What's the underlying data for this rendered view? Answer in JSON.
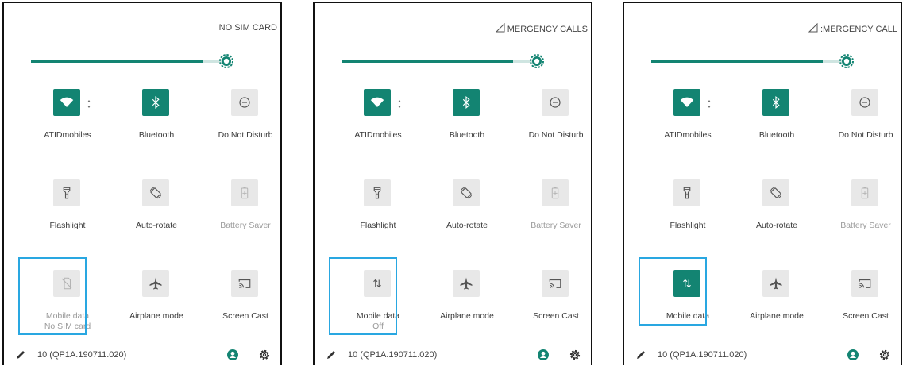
{
  "colors": {
    "accent": "#138472",
    "highlight": "#29a7e1",
    "tile_off": "#e8e8e8"
  },
  "panels": [
    {
      "status_text": "NO SIM CARD",
      "status_icon": "",
      "tiles": [
        {
          "label": "ATIDmobiles",
          "sub": "",
          "icon": "wifi-icon",
          "state": "on"
        },
        {
          "label": "Bluetooth",
          "sub": "",
          "icon": "bluetooth-icon",
          "state": "on"
        },
        {
          "label": "Do Not Disturb",
          "sub": "",
          "icon": "do-not-disturb-icon",
          "state": "off"
        },
        {
          "label": "Flashlight",
          "sub": "",
          "icon": "flashlight-icon",
          "state": "off"
        },
        {
          "label": "Auto-rotate",
          "sub": "",
          "icon": "auto-rotate-icon",
          "state": "off"
        },
        {
          "label": "Battery Saver",
          "sub": "",
          "icon": "battery-saver-icon",
          "state": "disabled"
        },
        {
          "label": "Mobile data",
          "sub": "No SIM card",
          "icon": "mobile-data-off-icon",
          "state": "disabled"
        },
        {
          "label": "Airplane mode",
          "sub": "",
          "icon": "airplane-icon",
          "state": "off"
        },
        {
          "label": "Screen Cast",
          "sub": "",
          "icon": "screen-cast-icon",
          "state": "off"
        }
      ],
      "build": "10 (QP1A.190711.020)"
    },
    {
      "status_text": "MERGENCY CALLS",
      "status_icon": "signal-icon",
      "tiles": [
        {
          "label": "ATIDmobiles",
          "sub": "",
          "icon": "wifi-icon",
          "state": "on"
        },
        {
          "label": "Bluetooth",
          "sub": "",
          "icon": "bluetooth-icon",
          "state": "on"
        },
        {
          "label": "Do Not Disturb",
          "sub": "",
          "icon": "do-not-disturb-icon",
          "state": "off"
        },
        {
          "label": "Flashlight",
          "sub": "",
          "icon": "flashlight-icon",
          "state": "off"
        },
        {
          "label": "Auto-rotate",
          "sub": "",
          "icon": "auto-rotate-icon",
          "state": "off"
        },
        {
          "label": "Battery Saver",
          "sub": "",
          "icon": "battery-saver-icon",
          "state": "disabled"
        },
        {
          "label": "Mobile data",
          "sub": "Off",
          "icon": "mobile-data-icon",
          "state": "off"
        },
        {
          "label": "Airplane mode",
          "sub": "",
          "icon": "airplane-icon",
          "state": "off"
        },
        {
          "label": "Screen Cast",
          "sub": "",
          "icon": "screen-cast-icon",
          "state": "off"
        }
      ],
      "build": "10 (QP1A.190711.020)"
    },
    {
      "status_text": ":MERGENCY CALL",
      "status_icon": "signal-icon",
      "tiles": [
        {
          "label": "ATIDmobiles",
          "sub": "",
          "icon": "wifi-icon",
          "state": "on"
        },
        {
          "label": "Bluetooth",
          "sub": "",
          "icon": "bluetooth-icon",
          "state": "on"
        },
        {
          "label": "Do Not Disturb",
          "sub": "",
          "icon": "do-not-disturb-icon",
          "state": "off"
        },
        {
          "label": "Flashlight",
          "sub": "",
          "icon": "flashlight-icon",
          "state": "off"
        },
        {
          "label": "Auto-rotate",
          "sub": "",
          "icon": "auto-rotate-icon",
          "state": "off"
        },
        {
          "label": "Battery Saver",
          "sub": "",
          "icon": "battery-saver-icon",
          "state": "disabled"
        },
        {
          "label": "Mobile data",
          "sub": "",
          "icon": "mobile-data-icon",
          "state": "on"
        },
        {
          "label": "Airplane mode",
          "sub": "",
          "icon": "airplane-icon",
          "state": "off"
        },
        {
          "label": "Screen Cast",
          "sub": "",
          "icon": "screen-cast-icon",
          "state": "off"
        }
      ],
      "build": "10 (QP1A.190711.020)"
    }
  ]
}
